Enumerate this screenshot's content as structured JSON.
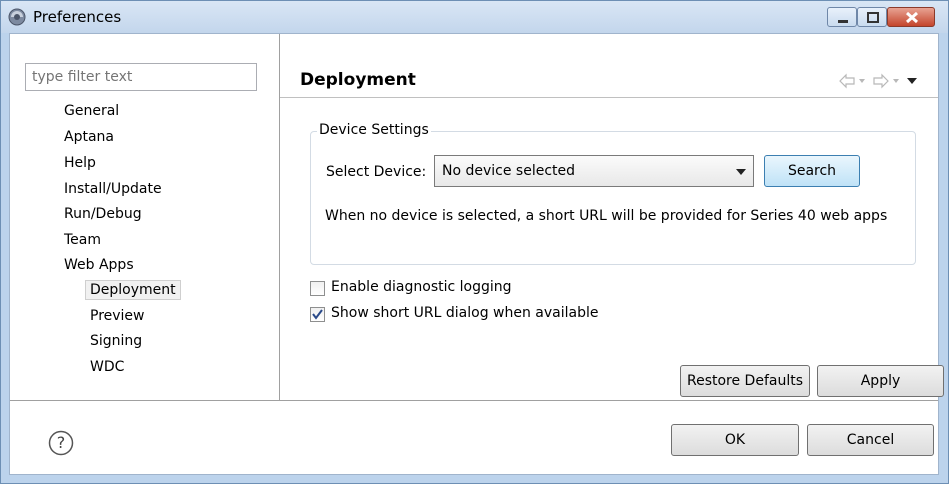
{
  "window": {
    "title": "Preferences"
  },
  "filter": {
    "placeholder": "type filter text"
  },
  "tree": {
    "items": [
      {
        "label": "General",
        "level": 0
      },
      {
        "label": "Aptana",
        "level": 0
      },
      {
        "label": "Help",
        "level": 0
      },
      {
        "label": "Install/Update",
        "level": 0
      },
      {
        "label": "Run/Debug",
        "level": 0
      },
      {
        "label": "Team",
        "level": 0
      },
      {
        "label": "Web Apps",
        "level": 0
      },
      {
        "label": "Deployment",
        "level": 1,
        "selected": true
      },
      {
        "label": "Preview",
        "level": 1
      },
      {
        "label": "Signing",
        "level": 1
      },
      {
        "label": "WDC",
        "level": 1
      }
    ]
  },
  "page": {
    "title": "Deployment",
    "nav_icons": [
      "back-arrow-icon",
      "dropdown-icon",
      "forward-arrow-icon",
      "dropdown-icon",
      "view-menu-icon"
    ]
  },
  "device_settings": {
    "group_title": "Device Settings",
    "select_label": "Select Device:",
    "select_value": "No device selected",
    "search_label": "Search",
    "hint": "When no device is selected, a short URL will be provided for Series 40 web apps"
  },
  "options": {
    "diagnostic_logging": {
      "label": "Enable diagnostic logging",
      "checked": false
    },
    "short_url_dialog": {
      "label": "Show short URL dialog when available",
      "checked": true
    }
  },
  "buttons": {
    "restore_defaults": "Restore Defaults",
    "apply": "Apply",
    "ok": "OK",
    "cancel": "Cancel"
  },
  "colors": {
    "title_bar": "#c3d6ec",
    "close_button": "#c4452c",
    "search_button": "#bfe2f7"
  }
}
